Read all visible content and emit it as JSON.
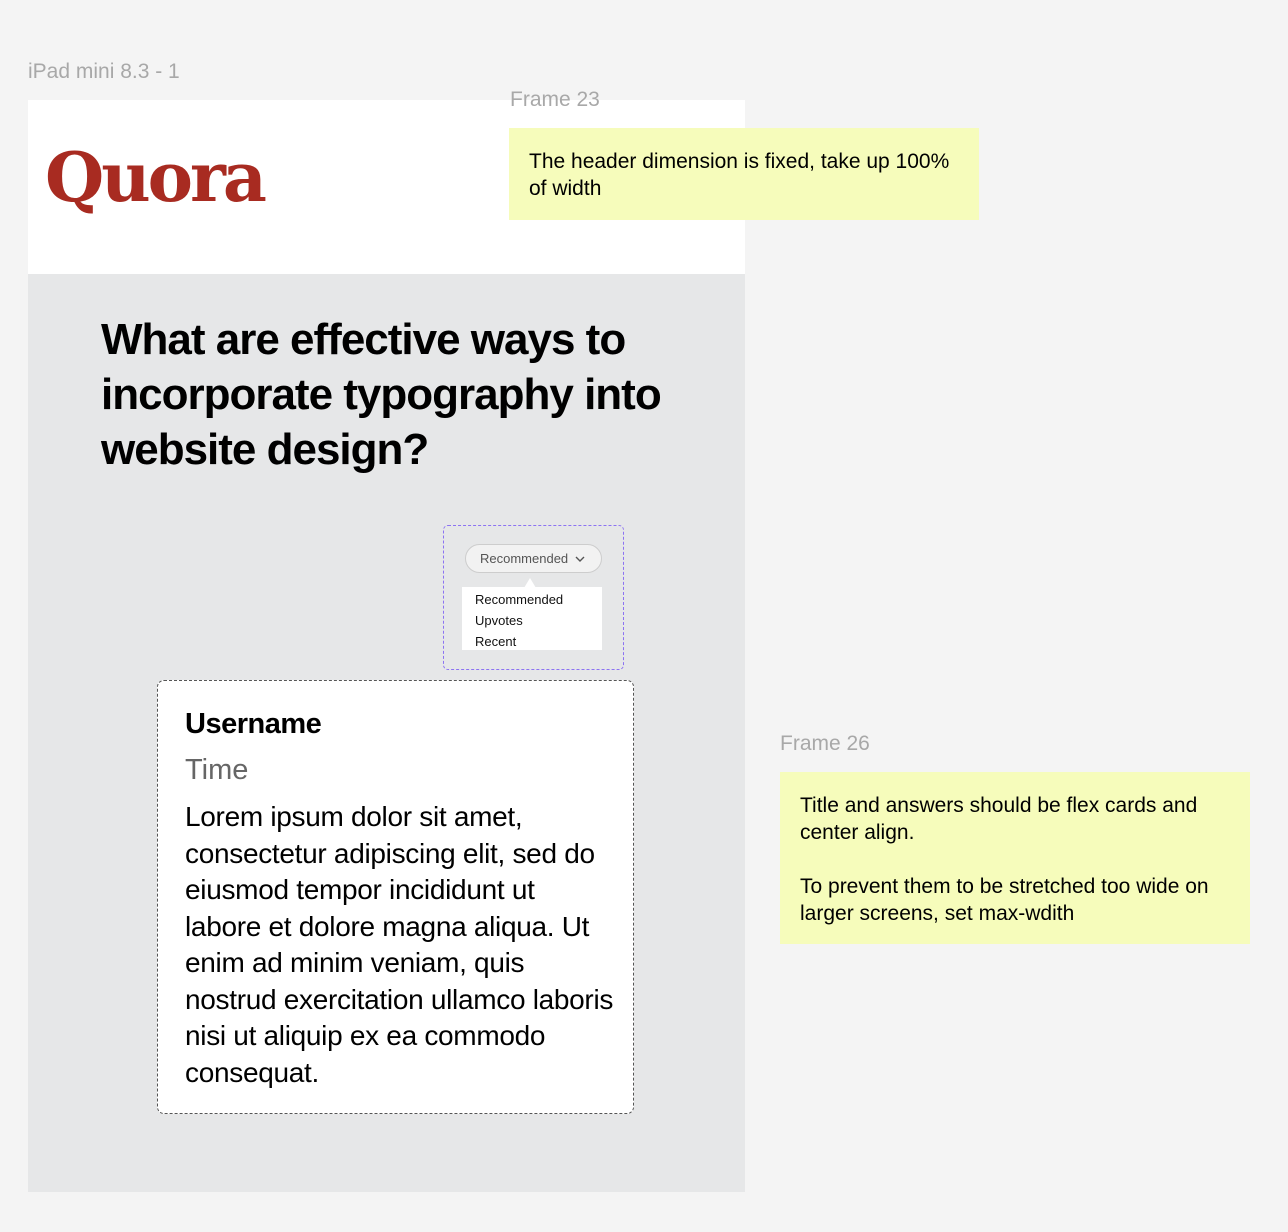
{
  "canvas": {
    "ipad_frame_label": "iPad mini 8.3 - 1",
    "frame23_label": "Frame 23",
    "frame26_label": "Frame 26"
  },
  "header": {
    "logo_text": "Quora",
    "logo_color": "#a82b21"
  },
  "question": {
    "title": "What are effective ways to incorporate typography into website design?"
  },
  "sort_dropdown": {
    "selected": "Recommended",
    "icon": "chevron-down-icon",
    "options": [
      "Recommended",
      "Upvotes",
      "Recent"
    ]
  },
  "answer": {
    "username": "Username",
    "time": "Time",
    "body": "Lorem ipsum dolor sit amet, consectetur adipiscing elit, sed do eiusmod tempor incididunt ut labore et dolore magna aliqua. Ut enim ad minim veniam, quis nostrud exercitation ullamco laboris nisi ut aliquip ex ea commodo consequat."
  },
  "notes": {
    "header_note": "The header dimension is fixed, take up 100% of width",
    "cards_note_line1": "Title and answers should be flex cards and center align.",
    "cards_note_line2": "To prevent them to be stretched too wide on larger screens, set max-wdith",
    "note_color": "#f6fcbb"
  },
  "colors": {
    "background": "#f4f4f4",
    "frame_body": "#e6e7e8",
    "dropdown_outline": "#8c73f2"
  }
}
